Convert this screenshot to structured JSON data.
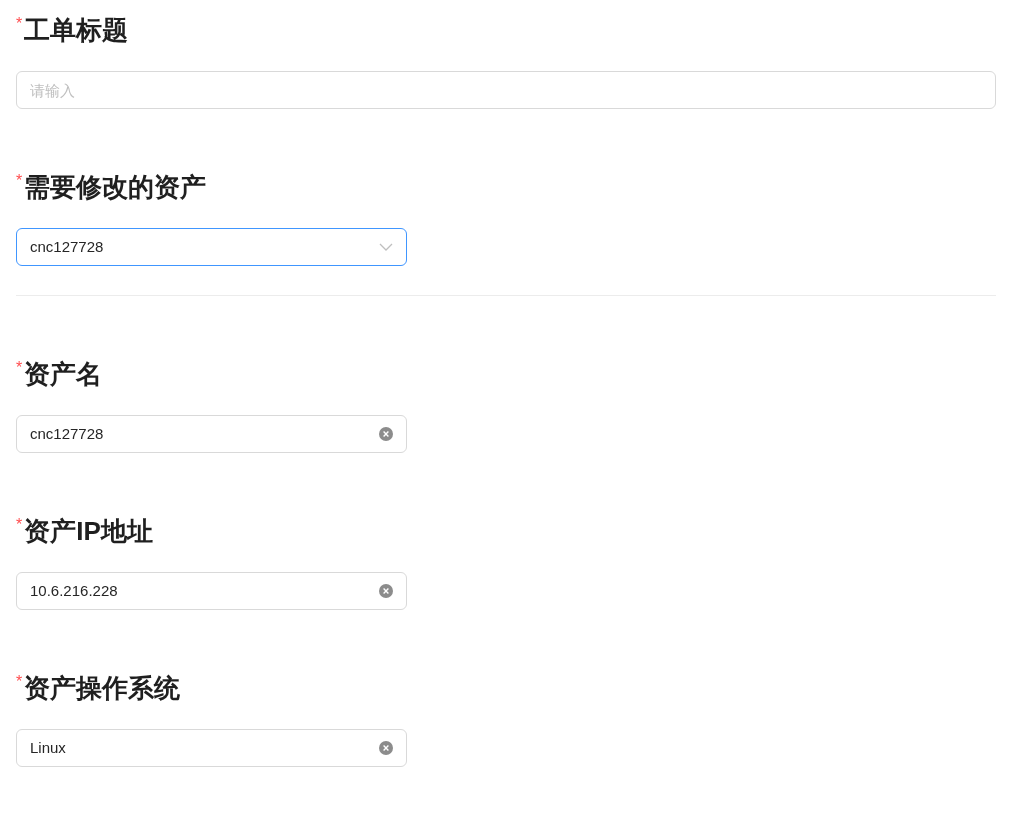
{
  "items": [
    {
      "kind": "input",
      "required_mark": "*",
      "label": "工单标题",
      "placeholder": "请输入"
    },
    {
      "kind": "select",
      "required_mark": "*",
      "label": "需要修改的资产",
      "value": "cnc127728",
      "focused": true
    },
    {
      "kind": "divider"
    },
    {
      "kind": "clearable",
      "required_mark": "*",
      "label": "资产名",
      "value": "cnc127728"
    },
    {
      "kind": "clearable",
      "required_mark": "*",
      "label": "资产IP地址",
      "value": "10.6.216.228"
    },
    {
      "kind": "clearable",
      "required_mark": "*",
      "label": "资产操作系统",
      "value": "Linux"
    }
  ]
}
